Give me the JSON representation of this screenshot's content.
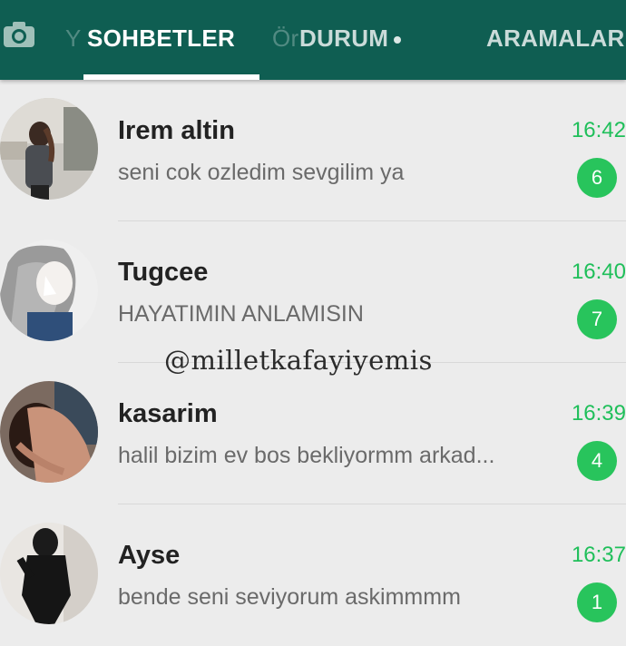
{
  "header": {
    "camera_icon": "camera-icon",
    "tabs": {
      "ghost_left": "Y",
      "chats": "SOHBETLER",
      "ghost_status": "Ör",
      "status": "DURUM",
      "calls": "ARAMALAR"
    }
  },
  "colors": {
    "header_bg": "#0f5e52",
    "accent_green": "#28c45c",
    "time_green": "#1fbf5a"
  },
  "chats": [
    {
      "name": "Irem altin",
      "message": "seni cok ozledim sevgilim ya",
      "time": "16:42",
      "unread": "6"
    },
    {
      "name": "Tugcee",
      "message": "HAYATIMIN ANLAMISIN",
      "time": "16:40",
      "unread": "7"
    },
    {
      "name": "kasarim",
      "message": "halil bizim ev bos  bekliyormm arkad...",
      "time": "16:39",
      "unread": "4"
    },
    {
      "name": "Ayse",
      "message": "bende seni seviyorum askimmmm",
      "time": "16:37",
      "unread": "1"
    }
  ],
  "watermark": "@milletkafayiyemis"
}
